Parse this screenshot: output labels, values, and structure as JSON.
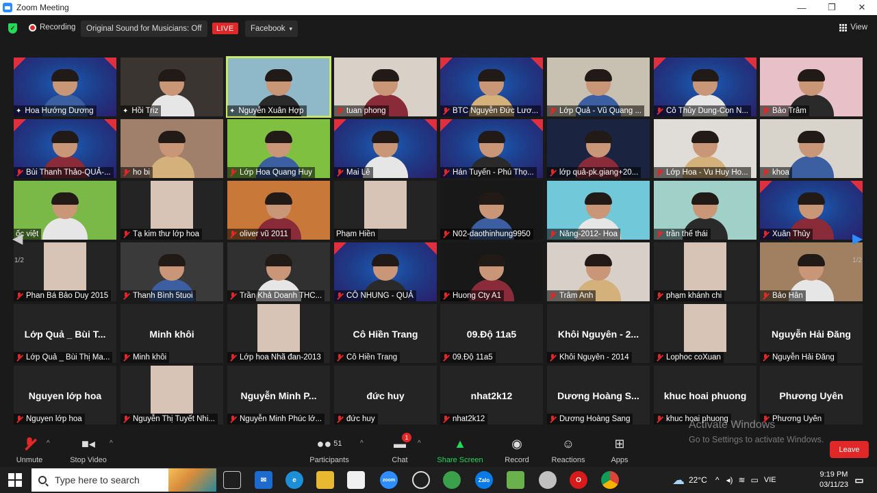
{
  "window": {
    "title": "Zoom Meeting",
    "ctrl_min": "—",
    "ctrl_max": "❐",
    "ctrl_close": "✕"
  },
  "topbar": {
    "recording": "Recording",
    "original_sound": "Original Sound for Musicians: Off",
    "live": "LIVE",
    "facebook": "Facebook",
    "facebook_caret": "▾",
    "view": "View"
  },
  "gallery": {
    "page": "1/2",
    "page_right": "1/2"
  },
  "tiles": [
    {
      "name": "Hoa Hướng Dương",
      "icon": "pin",
      "bg": "stage"
    },
    {
      "name": "Hồi Triz",
      "icon": "pin",
      "bg": "#3a3530"
    },
    {
      "name": "Nguyễn Xuân Hợp",
      "icon": "pin",
      "bg": "#8fb8c8",
      "speaking": true
    },
    {
      "name": "tuan phong",
      "icon": "mic",
      "bg": "#d9d0c8"
    },
    {
      "name": "BTC Nguyễn Đức Lươ...",
      "icon": "mic",
      "bg": "stage"
    },
    {
      "name": "Lớp Quả - Vũ Quang ...",
      "icon": "mic",
      "bg": "#c8c0b0"
    },
    {
      "name": "Cô Thủy Dung-Con N...",
      "icon": "mic",
      "bg": "stage"
    },
    {
      "name": "Bảo Trâm",
      "icon": "mic",
      "bg": "#e8c0c8"
    },
    {
      "name": "Bùi Thanh Thảo-QUẢ-...",
      "icon": "mic",
      "bg": "stage"
    },
    {
      "name": "ho bi",
      "icon": "mic",
      "bg": "#a0806a"
    },
    {
      "name": "Lớp Hoa Quang Huy",
      "icon": "mic",
      "bg": "#80c040"
    },
    {
      "name": "Mai Lê",
      "icon": "mic",
      "bg": "stage"
    },
    {
      "name": "Hán Tuyến - Phú Thọ...",
      "icon": "mic",
      "bg": "stage"
    },
    {
      "name": "lớp quả-pk.giang+20...",
      "icon": "mic",
      "bg": "#1a2440"
    },
    {
      "name": "Lớp Hoa - Vu Huy Ho...",
      "icon": "mic",
      "bg": "#e0ddd8"
    },
    {
      "name": "khoa",
      "icon": "mic",
      "bg": "#d8d4cc"
    },
    {
      "name": "ốc việt",
      "icon": "none",
      "bg": "#7ab848"
    },
    {
      "name": "Tạ kim thư lớp hoa",
      "icon": "mic",
      "bg": "#242424"
    },
    {
      "name": "oliver vũ 2011",
      "icon": "mic",
      "bg": "#c87838"
    },
    {
      "name": "Phạm Hiền",
      "icon": "none",
      "bg": "#242424"
    },
    {
      "name": "N02-daothinhung9950",
      "icon": "mic",
      "bg": "#181818"
    },
    {
      "name": "Năng-2012- Hoa",
      "icon": "mic",
      "bg": "#70c8d8"
    },
    {
      "name": "trần thế thái",
      "icon": "mic",
      "bg": "#a0d0c8"
    },
    {
      "name": "Xuân Thủy",
      "icon": "mic",
      "bg": "stage"
    },
    {
      "name": "Phan Bá Bảo Duy 2015",
      "icon": "mic",
      "bg": "#242424"
    },
    {
      "name": "Thanh Bình 5tuoi",
      "icon": "mic",
      "bg": "#3a3a3a"
    },
    {
      "name": "Trần Khả Doanh THC...",
      "icon": "mic",
      "bg": "#303030"
    },
    {
      "name": "CÔ NHUNG - QUẢ",
      "icon": "mic",
      "bg": "stage"
    },
    {
      "name": "Huong Cty A1",
      "icon": "mic",
      "bg": "#181818"
    },
    {
      "name": "Trâm Anh",
      "icon": "mic",
      "bg": "#d8d0c8"
    },
    {
      "name": "phạm khánh chi",
      "icon": "mic",
      "bg": "#242424"
    },
    {
      "name": "Bảo Hân",
      "icon": "mic",
      "bg": "#a08060"
    },
    {
      "name": "Lớp Quả _ Bùi Thị Ma...",
      "big": "Lớp Quả _ Bùi T...",
      "icon": "mic",
      "bg": "#242424"
    },
    {
      "name": "Minh khôi",
      "big": "Minh khôi",
      "icon": "mic",
      "bg": "#242424"
    },
    {
      "name": "Lớp hoa Nhã đan-2013",
      "icon": "mic",
      "bg": "#242424"
    },
    {
      "name": "Cô Hiền Trang",
      "big": "Cô Hiền Trang",
      "icon": "mic",
      "bg": "#242424"
    },
    {
      "name": "09.Độ 11a5",
      "big": "09.Độ 11a5",
      "icon": "mic",
      "bg": "#242424"
    },
    {
      "name": "Khôi Nguyên - 2014",
      "big": "Khôi Nguyên - 2...",
      "icon": "mic",
      "bg": "#242424"
    },
    {
      "name": "Lophoc coXuan",
      "icon": "mic",
      "bg": "#242424"
    },
    {
      "name": "Nguyễn Hải Đăng",
      "big": "Nguyễn Hải Đăng",
      "icon": "mic",
      "bg": "#242424"
    },
    {
      "name": "Nguyen lớp hoa",
      "big": "Nguyen lớp hoa",
      "icon": "mic",
      "bg": "#242424"
    },
    {
      "name": "Nguyễn Thị Tuyết Nhi...",
      "icon": "mic",
      "bg": "#242424"
    },
    {
      "name": "Nguyễn Minh Phúc lớ...",
      "big": "Nguyễn  Minh  P...",
      "icon": "mic",
      "bg": "#242424"
    },
    {
      "name": "đức huy",
      "big": "đức huy",
      "icon": "mic",
      "bg": "#242424"
    },
    {
      "name": "nhat2k12",
      "big": "nhat2k12",
      "icon": "mic",
      "bg": "#242424"
    },
    {
      "name": "Dương Hoàng Sang",
      "big": "Dương  Hoàng  S...",
      "icon": "mic",
      "bg": "#242424"
    },
    {
      "name": "khuc hoai phuong",
      "big": "khuc hoai phuong",
      "icon": "mic",
      "bg": "#242424"
    },
    {
      "name": "Phương Uyên",
      "big": "Phương Uyên",
      "icon": "mic",
      "bg": "#242424"
    }
  ],
  "toolbar": {
    "unmute": "Unmute",
    "stop_video": "Stop Video",
    "participants": "Participants",
    "participants_count": "51",
    "chat": "Chat",
    "chat_badge": "1",
    "share_screen": "Share Screen",
    "record": "Record",
    "reactions": "Reactions",
    "apps": "Apps",
    "leave": "Leave"
  },
  "watermark": {
    "line1": "Activate Windows",
    "line2": "Go to Settings to activate Windows."
  },
  "taskbar": {
    "search_placeholder": "Type here to search",
    "weather": "22°C",
    "lang": "VIE",
    "time": "9:19 PM",
    "date": "03/11/23"
  },
  "colors": {
    "speaking": "#c8e86a",
    "share": "#23d959",
    "leave": "#e02828",
    "accent": "#2d8cff"
  }
}
